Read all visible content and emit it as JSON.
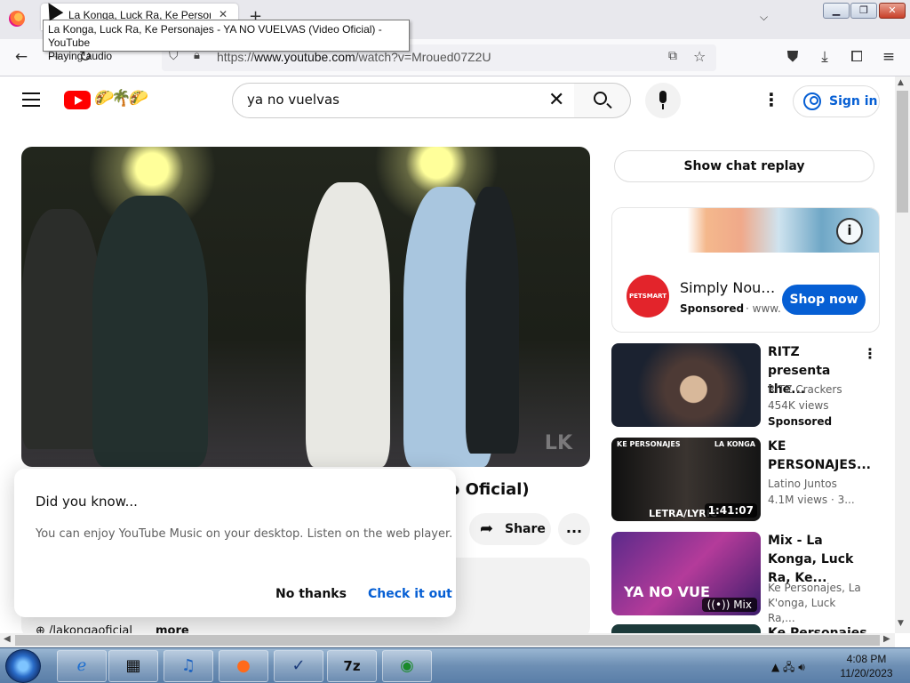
{
  "browser": {
    "tab_title": "La Konga, Luck Ra, Ke Personajes",
    "tooltip_line1": "La Konga, Luck Ra, Ke Personajes - YA NO VUELVAS (Video Oficial) - YouTube",
    "tooltip_line2": "Playing audio",
    "url_prefix": "https://",
    "url_host": "www.youtube.com",
    "url_path": "/watch?v=Mroued07Z2U"
  },
  "youtube": {
    "search_value": "ya no vuelvas",
    "sign_in_label": "Sign in",
    "video_title_partial": "o Oficial)",
    "share_label": "Share",
    "more_label": "...",
    "channel_handle": "/lakongaoficial",
    "more_text": "more",
    "show_chat_replay": "Show chat replay",
    "watermark": "LK"
  },
  "dialog": {
    "title": "Did you know...",
    "body": "You can enjoy YouTube Music on your desktop. Listen on the web player.",
    "no_thanks": "No thanks",
    "check_it_out": "Check it out"
  },
  "ad": {
    "name": "Simply Nouri...",
    "sponsored": "Sponsored",
    "domain": "· www.",
    "cta": "Shop now",
    "logo_text": "PETSMART"
  },
  "recommendations": [
    {
      "title": "RITZ presenta the...",
      "channel": "RITZ Crackers",
      "stats": "454K views",
      "sponsored": "Sponsored",
      "duration": ""
    },
    {
      "title": "KE PERSONAJES...",
      "channel": "Latino Juntos",
      "stats": "4.1M views  · 3...",
      "duration": "1:41:07",
      "thumb_label": "LETRA/LYRIC",
      "thumb_top_left": "KE PERSONAJES",
      "thumb_top_right": "LA KONGA"
    },
    {
      "title": "Mix - La Konga, Luck Ra, Ke...",
      "channel": "Ke Personajes, La K'onga, Luck Ra,...",
      "mix_label": "Mix",
      "thumb_text": "YA NO VUE"
    },
    {
      "title": "Ke Personajes"
    }
  ],
  "taskbar": {
    "time": "4:08 PM",
    "date": "11/20/2023"
  },
  "colors": {
    "youtube_red": "#ff0000",
    "link_blue": "#065fd4"
  }
}
